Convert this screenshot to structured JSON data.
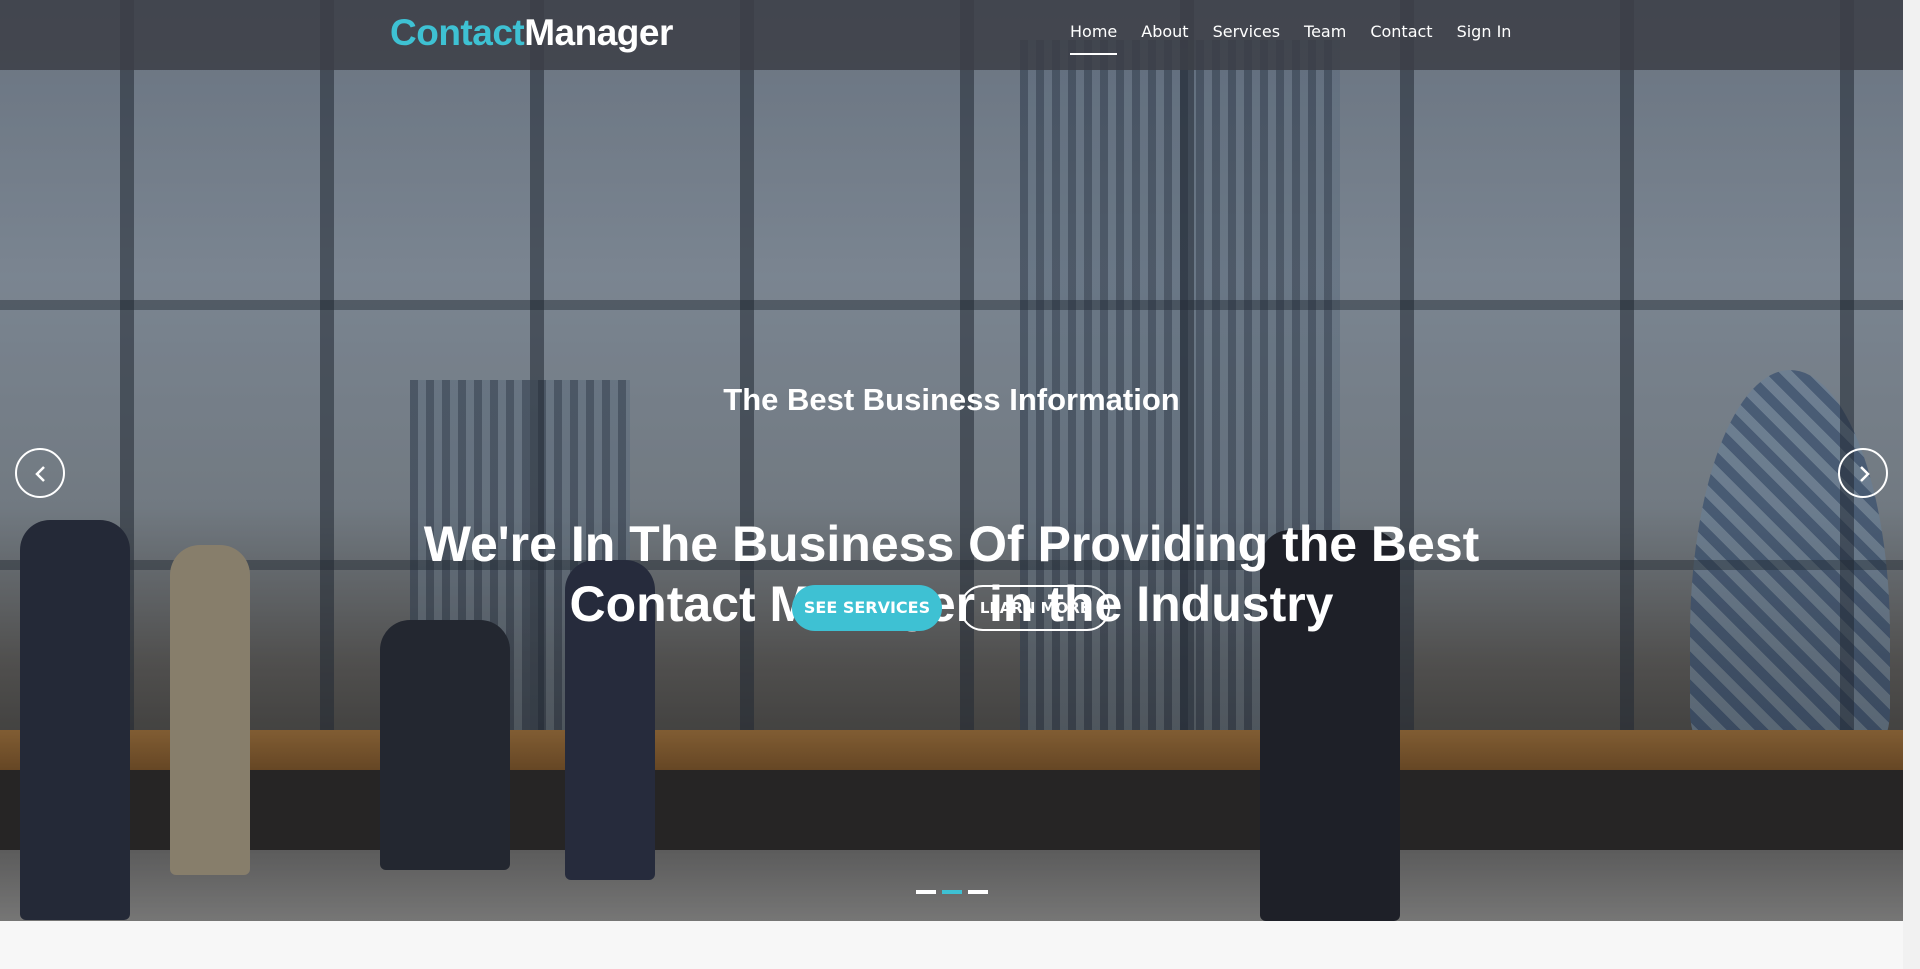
{
  "brand": {
    "part1": "Contact",
    "part2": "Manager",
    "accent_color": "#3ec1d3"
  },
  "nav": {
    "items": [
      {
        "label": "Home",
        "active": true
      },
      {
        "label": "About",
        "active": false
      },
      {
        "label": "Services",
        "active": false
      },
      {
        "label": "Team",
        "active": false
      },
      {
        "label": "Contact",
        "active": false
      },
      {
        "label": "Sign In",
        "active": false
      }
    ]
  },
  "hero": {
    "subtitle": "The Best Business Information",
    "headline": "We're In The Business Of Providing the Best Contact Manager in the Industry",
    "primary_button": "SEE SERVICES",
    "secondary_button": "LEARN MORE",
    "prev_icon": "chevron-left-icon",
    "next_icon": "chevron-right-icon",
    "slides": [
      {
        "active": false
      },
      {
        "active": true
      },
      {
        "active": false
      }
    ]
  }
}
